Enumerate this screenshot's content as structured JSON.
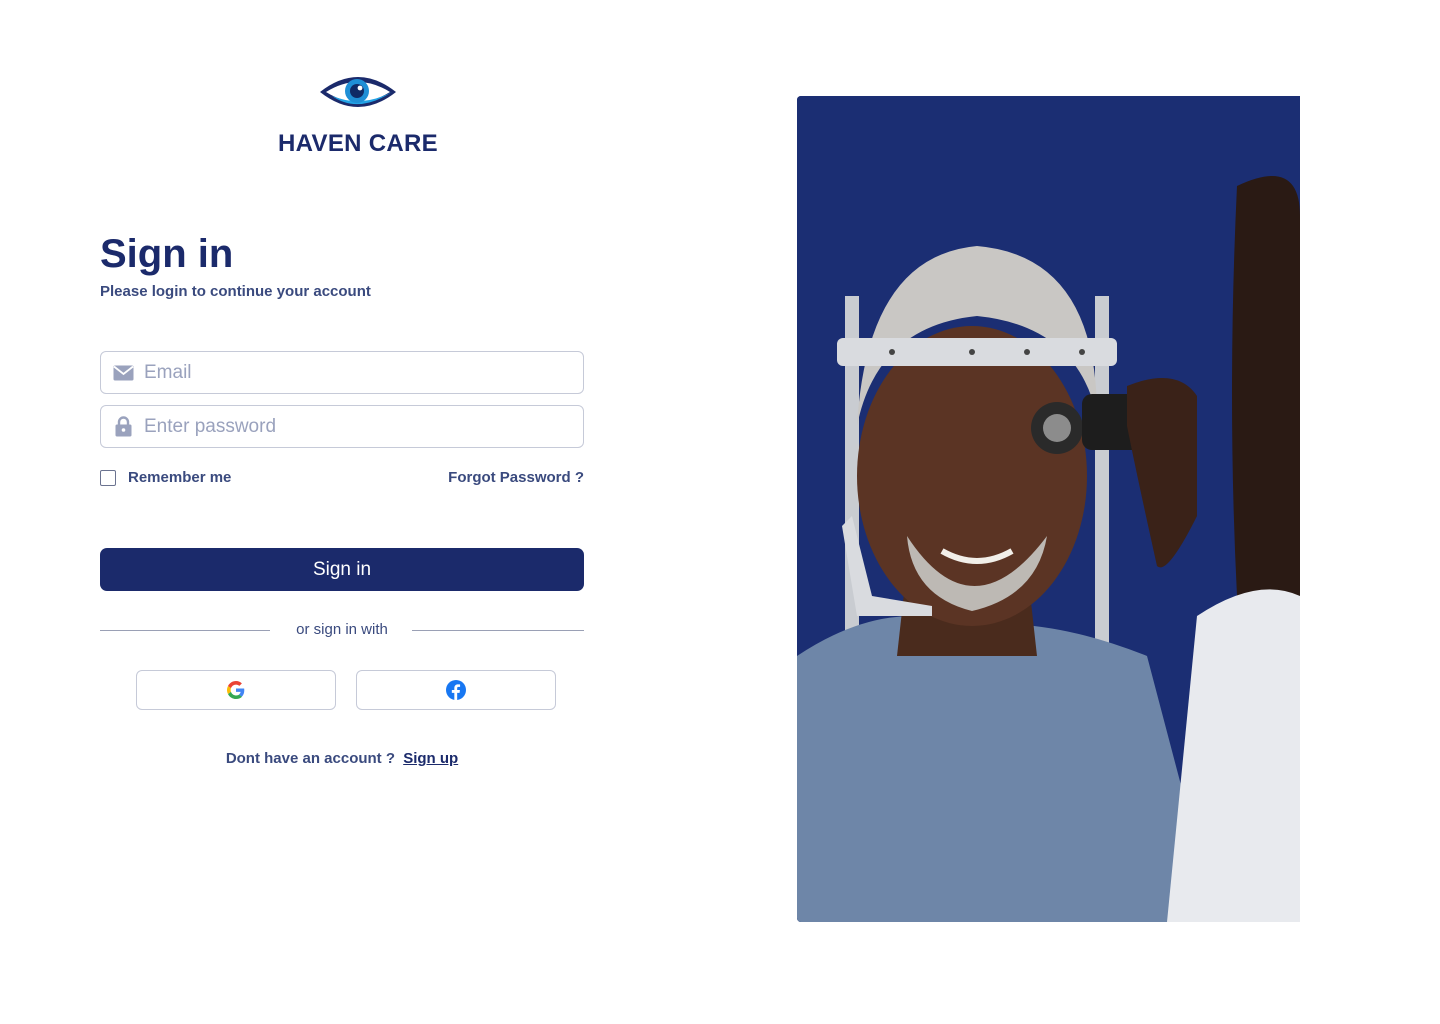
{
  "brand": {
    "name": "HAVEN CARE",
    "logo_icon": "eye-icon",
    "primary_color": "#1b2a6b",
    "accent_color": "#1f8fd6"
  },
  "form": {
    "title": "Sign in",
    "subtitle": "Please login to continue your account",
    "email_placeholder": "Email",
    "password_placeholder": "Enter password",
    "remember_label": "Remember me",
    "forgot_label": "Forgot Password ?",
    "submit_label": "Sign in",
    "divider_label": "or sign in with",
    "social": [
      {
        "provider": "google",
        "icon": "google-icon"
      },
      {
        "provider": "facebook",
        "icon": "facebook-icon"
      }
    ],
    "signup_prompt": "Dont have an account ?",
    "signup_link": "Sign up"
  },
  "hero": {
    "background_color": "#1b2e73"
  }
}
